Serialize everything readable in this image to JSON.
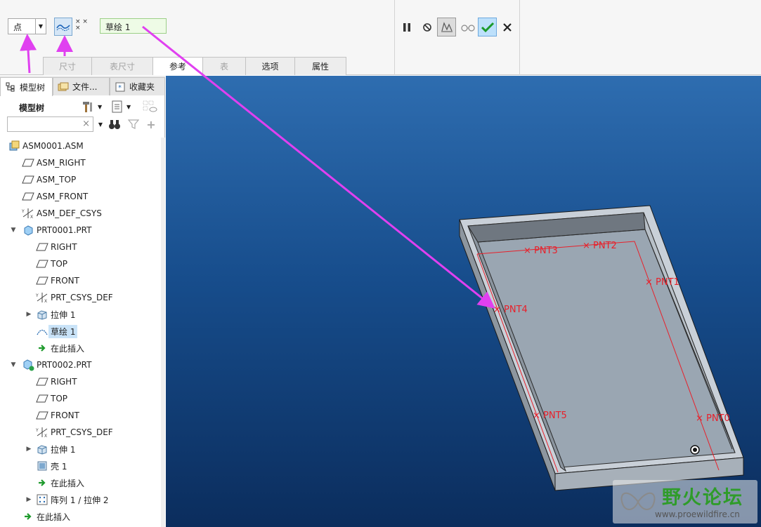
{
  "ribbon": {
    "select_type": "点",
    "reference_value": "草绘 1",
    "tabs": [
      {
        "label": "尺寸",
        "state": "disabled"
      },
      {
        "label": "表尺寸",
        "state": "disabled"
      },
      {
        "label": "参考",
        "state": "active"
      },
      {
        "label": "表",
        "state": "disabled"
      },
      {
        "label": "选项",
        "state": "normal"
      },
      {
        "label": "属性",
        "state": "normal"
      }
    ],
    "tools": [
      "pause-icon",
      "no-entry-icon",
      "preview-box-icon",
      "glasses-icon",
      "checkmark-icon",
      "close-icon"
    ]
  },
  "panel": {
    "tabs": [
      "模型树",
      "文件...",
      "收藏夹"
    ],
    "title": "模型树",
    "search_placeholder": ""
  },
  "tree": [
    {
      "label": "ASM0001.ASM",
      "icon": "assembly-icon",
      "level": 0
    },
    {
      "label": "ASM_RIGHT",
      "icon": "datum-plane-icon",
      "level": 1
    },
    {
      "label": "ASM_TOP",
      "icon": "datum-plane-icon",
      "level": 1
    },
    {
      "label": "ASM_FRONT",
      "icon": "datum-plane-icon",
      "level": 1
    },
    {
      "label": "ASM_DEF_CSYS",
      "icon": "csys-icon",
      "level": 1
    },
    {
      "label": "PRT0001.PRT",
      "icon": "part-icon",
      "level": 1,
      "expand": "open"
    },
    {
      "label": "RIGHT",
      "icon": "datum-plane-icon",
      "level": 2
    },
    {
      "label": "TOP",
      "icon": "datum-plane-icon",
      "level": 2
    },
    {
      "label": "FRONT",
      "icon": "datum-plane-icon",
      "level": 2
    },
    {
      "label": "PRT_CSYS_DEF",
      "icon": "csys-icon",
      "level": 2
    },
    {
      "label": "拉伸 1",
      "icon": "extrude-icon",
      "level": 2,
      "expand": "closed"
    },
    {
      "label": "草绘 1",
      "icon": "sketch-icon",
      "level": 2,
      "selected": true
    },
    {
      "label": "在此插入",
      "icon": "insert-arrow-icon",
      "level": 2
    },
    {
      "label": "PRT0002.PRT",
      "icon": "part-active-icon",
      "level": 1,
      "expand": "open"
    },
    {
      "label": "RIGHT",
      "icon": "datum-plane-icon",
      "level": 2
    },
    {
      "label": "TOP",
      "icon": "datum-plane-icon",
      "level": 2
    },
    {
      "label": "FRONT",
      "icon": "datum-plane-icon",
      "level": 2
    },
    {
      "label": "PRT_CSYS_DEF",
      "icon": "csys-icon",
      "level": 2
    },
    {
      "label": "拉伸 1",
      "icon": "extrude-icon",
      "level": 2,
      "expand": "closed"
    },
    {
      "label": "壳 1",
      "icon": "shell-icon",
      "level": 2
    },
    {
      "label": "在此插入",
      "icon": "insert-arrow-icon",
      "level": 2
    },
    {
      "label": "阵列 1 / 拉伸 2",
      "icon": "pattern-icon",
      "level": 2,
      "expand": "closed"
    },
    {
      "label": "在此插入",
      "icon": "insert-arrow-icon",
      "level": 1
    }
  ],
  "viewport": {
    "points": [
      "PNT3",
      "PNT2",
      "PNT1",
      "PNT4",
      "PNT5",
      "PNT0"
    ]
  },
  "watermark": {
    "title": "野火论坛",
    "url": "www.proewildfire.cn"
  },
  "colors": {
    "annotation_arrow": "#e040f0",
    "sketch_line": "#e8202a",
    "ribbon_bg": "#f6f6f6"
  }
}
